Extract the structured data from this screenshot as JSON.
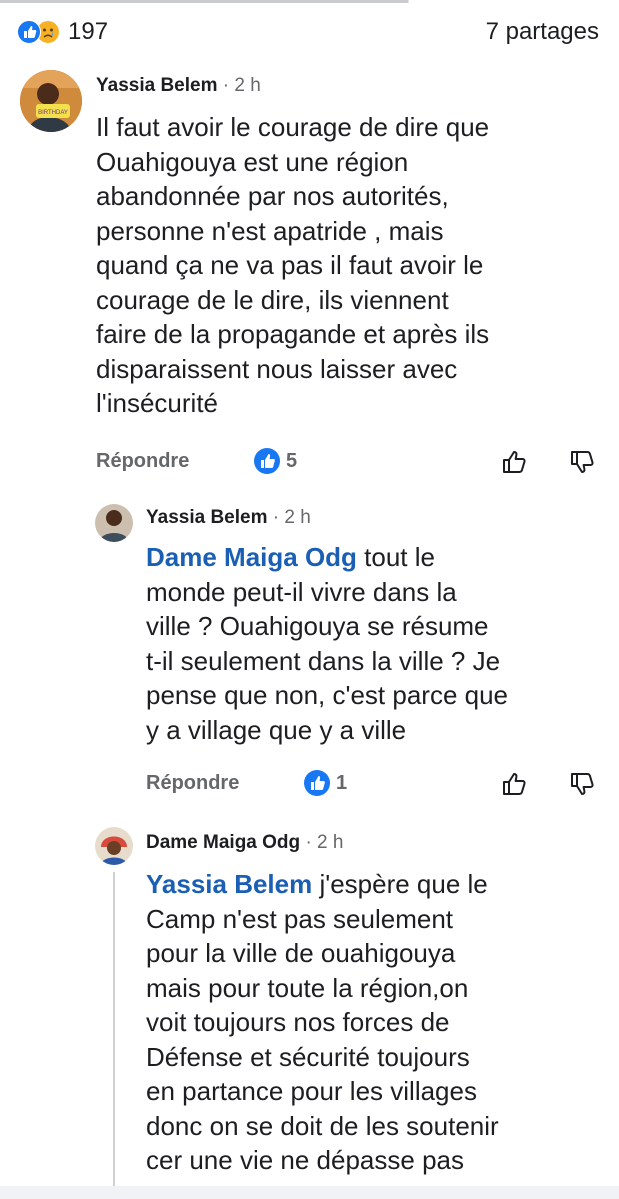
{
  "post_stats": {
    "reactions_count": "197",
    "shares_label": "7 partages",
    "reaction_icons": [
      "like-icon",
      "sad-icon"
    ],
    "colors": {
      "like": "#1877f2",
      "sad": "#f7b125"
    }
  },
  "comments": [
    {
      "author": "Yassia Belem",
      "separator": "·",
      "time": "2 h",
      "text": "Il faut avoir le courage de dire que\nOuahigouya est une région\nabandonnée par nos autorités,\npersonne n'est apatride , mais\nquand ça ne va pas il faut avoir le\ncourage de le dire, ils viennent\nfaire de la propagande et après ils\ndisparaissent nous laisser avec\nl'insécurité",
      "reply_label": "Répondre",
      "like_count": "5",
      "avatar_caption": "BIRTHDAY"
    },
    {
      "author": "Yassia Belem",
      "separator": "·",
      "time": "2 h",
      "mention": "Dame Maiga Odg",
      "text": " tout le\nmonde peut-il vivre dans la\nville ? Ouahigouya se résume\nt-il seulement dans la ville ? Je\npense que non, c'est parce que\ny a village que y a ville",
      "reply_label": "Répondre",
      "like_count": "1"
    },
    {
      "author": "Dame Maiga Odg",
      "separator": "·",
      "time": "2 h",
      "mention": "Yassia Belem",
      "text": " j'espère que le\nCamp n'est pas seulement\npour la ville de ouahigouya\nmais pour toute la région,on\nvoit toujours nos forces de\nDéfense et sécurité toujours\nen partance pour les villages\ndonc on se doit de les soutenir\ncer une vie ne dépasse pas"
    }
  ],
  "colors": {
    "mention": "#1a5fb4",
    "meta_text": "#65676b",
    "body_text": "#1c1e21"
  }
}
